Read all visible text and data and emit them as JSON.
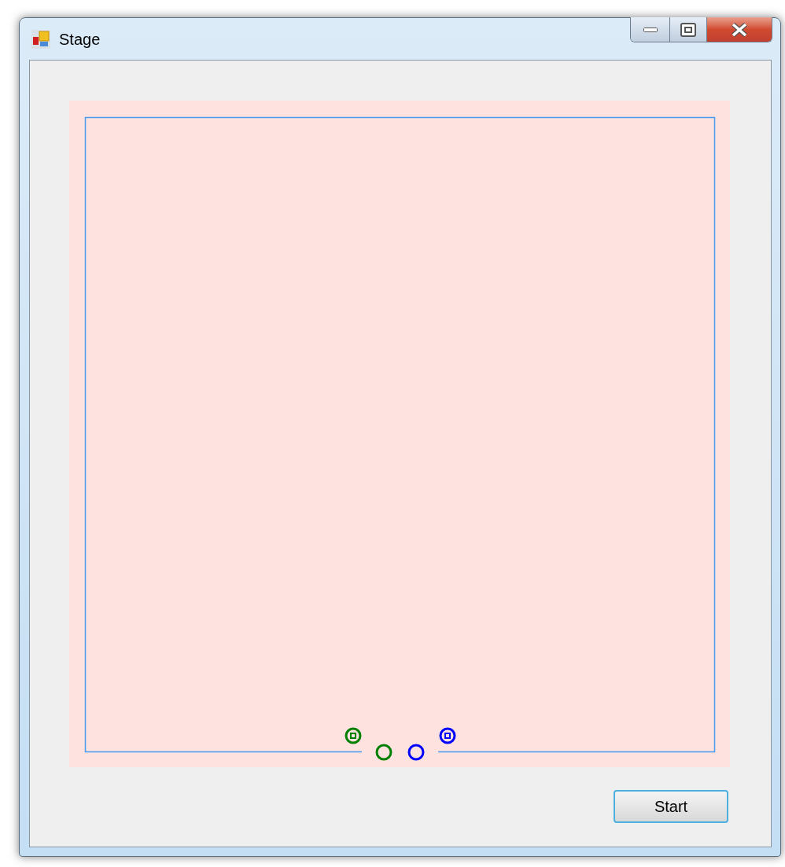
{
  "window": {
    "title": "Stage"
  },
  "stage": {
    "markers": [
      {
        "kind": "target",
        "color": "#008000"
      },
      {
        "kind": "ring",
        "color": "#008000"
      },
      {
        "kind": "ring",
        "color": "#0000ff"
      },
      {
        "kind": "target",
        "color": "#0000ff"
      }
    ]
  },
  "buttons": [
    {
      "label": "Start"
    }
  ]
}
